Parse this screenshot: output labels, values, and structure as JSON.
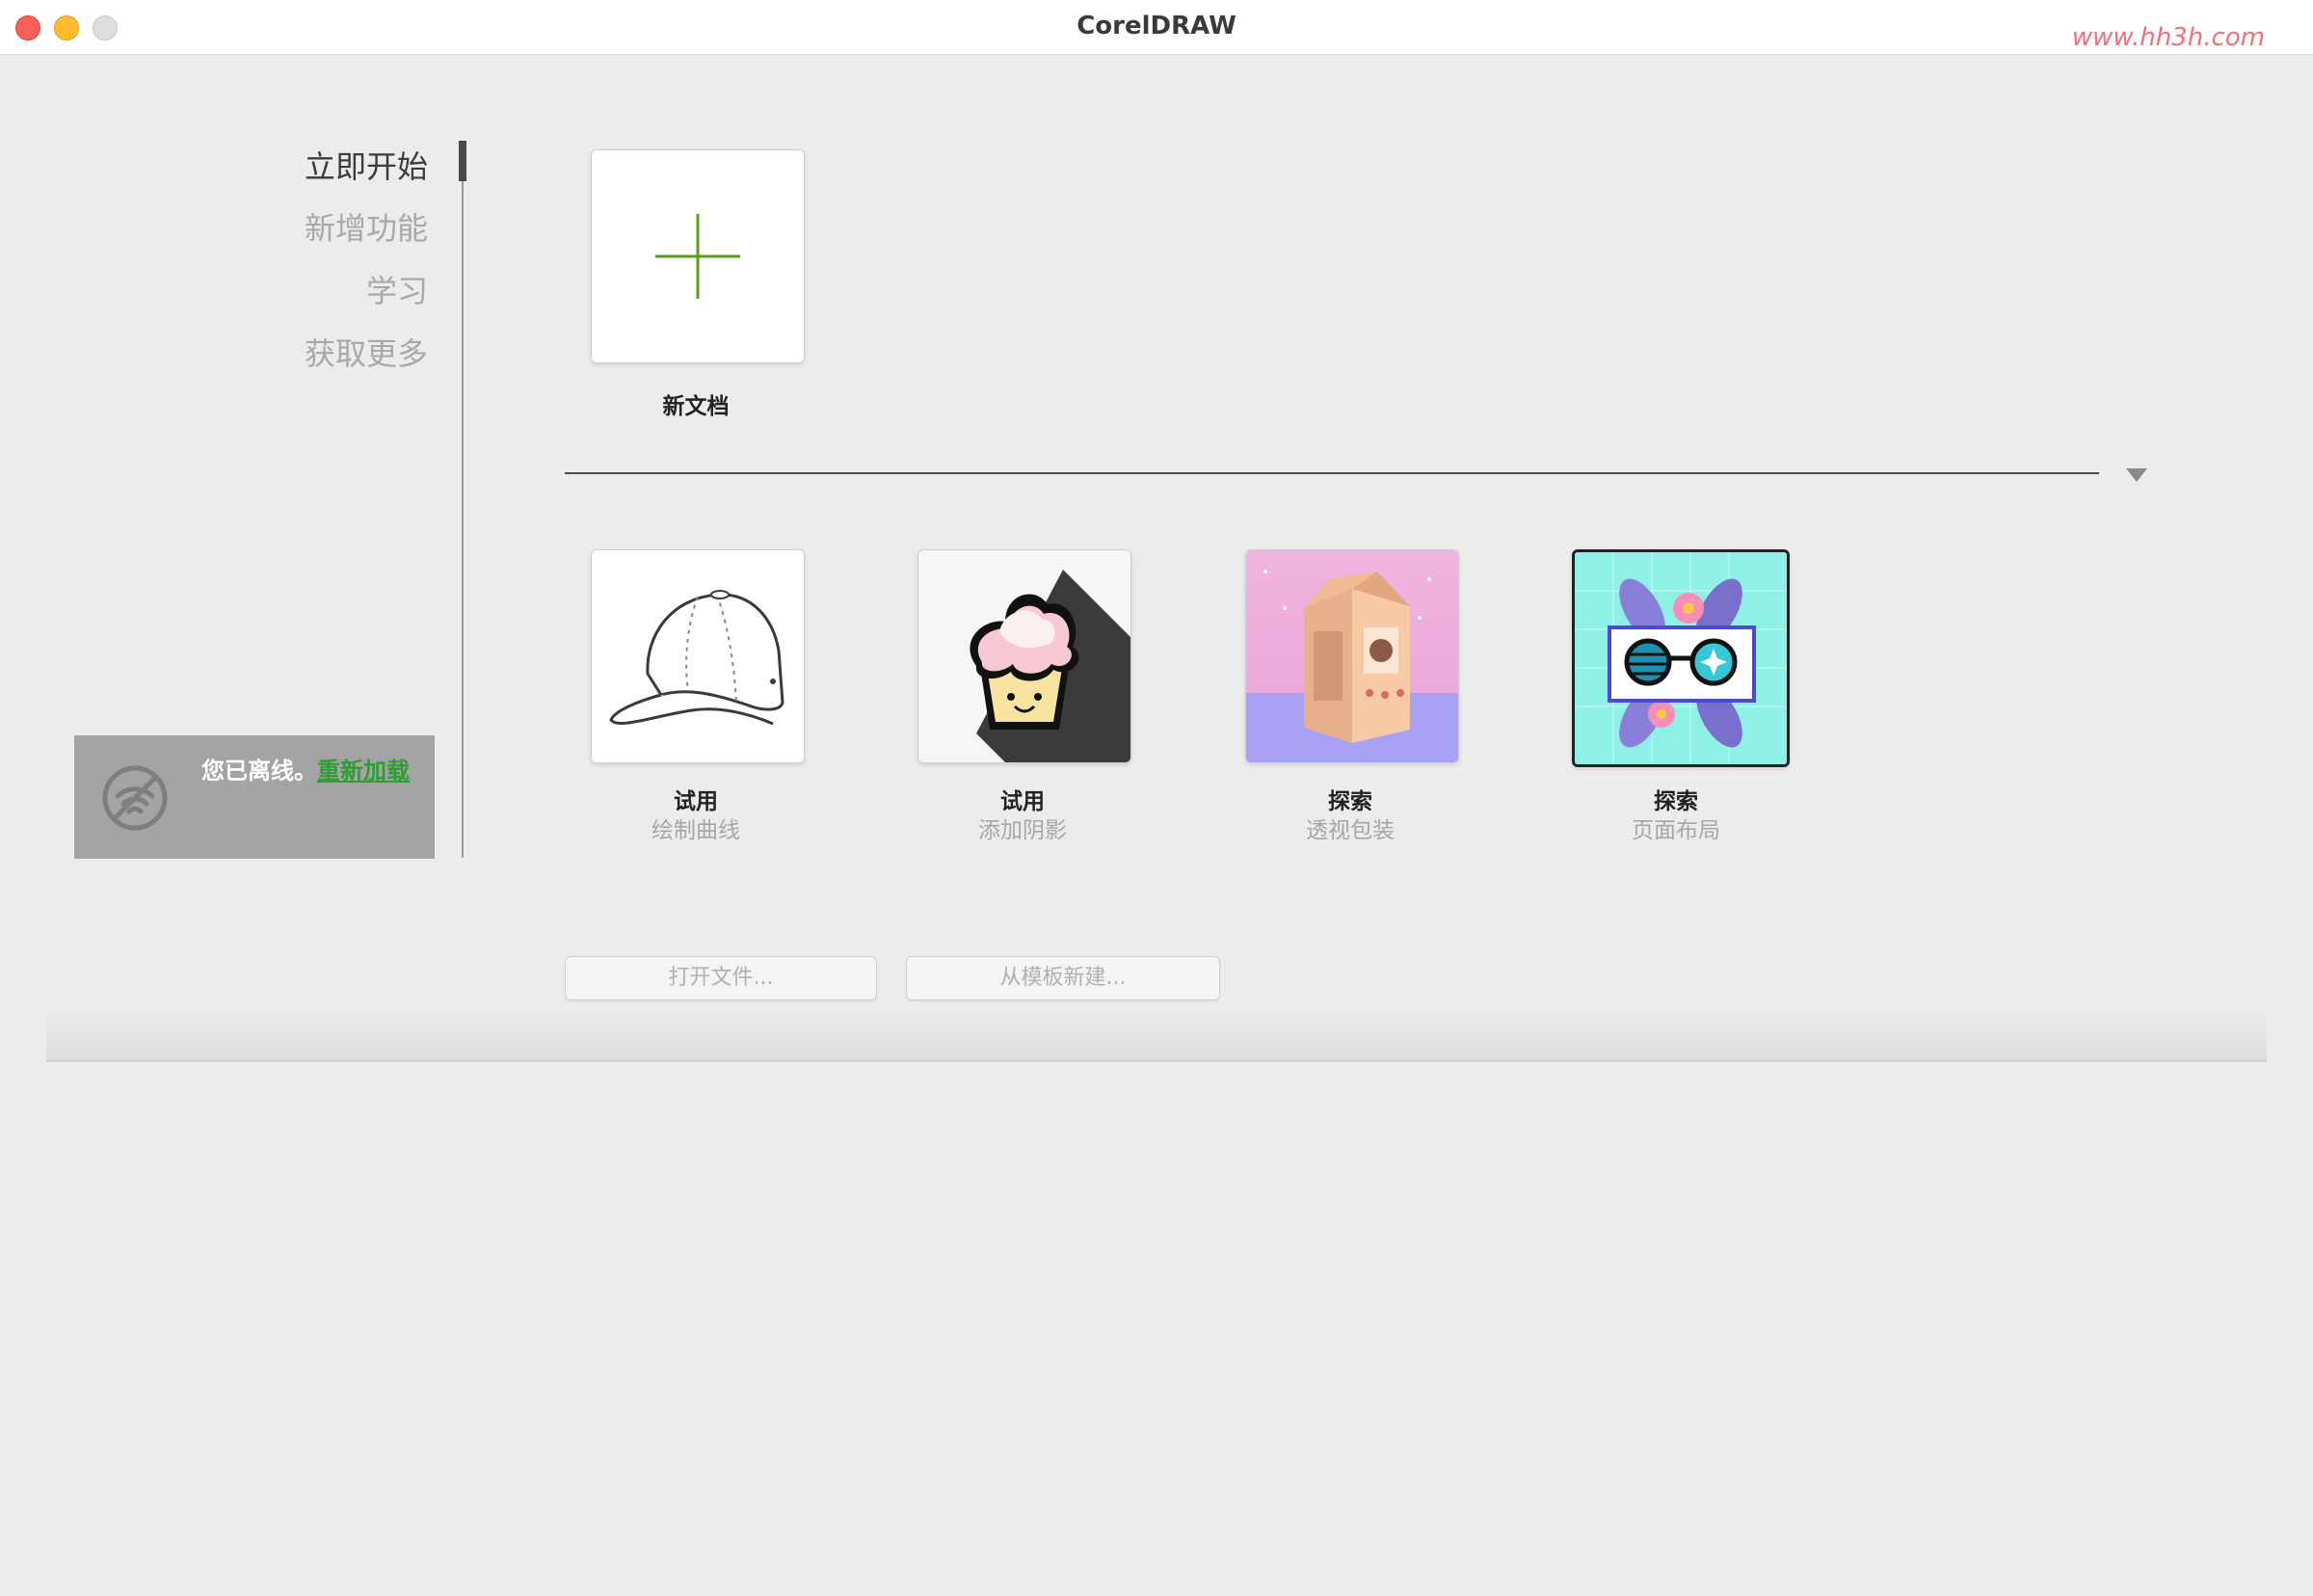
{
  "window": {
    "title": "CorelDRAW",
    "watermark": "www.hh3h.com"
  },
  "nav": {
    "items": [
      {
        "label": "立即开始",
        "active": true
      },
      {
        "label": "新增功能",
        "active": false
      },
      {
        "label": "学习",
        "active": false
      },
      {
        "label": "获取更多",
        "active": false
      }
    ]
  },
  "offline": {
    "message": "您已离线。",
    "reload_label": "重新加载",
    "icon": "no-wifi-icon"
  },
  "new_document": {
    "label": "新文档",
    "icon": "plus-icon",
    "accent_color": "#5a9e1c"
  },
  "tutorials": [
    {
      "title": "试用",
      "subtitle": "绘制曲线",
      "image": "baseball-cap-illustration"
    },
    {
      "title": "试用",
      "subtitle": "添加阴影",
      "image": "cupcake-illustration"
    },
    {
      "title": "探索",
      "subtitle": "透视包装",
      "image": "milk-carton-illustration"
    },
    {
      "title": "探索",
      "subtitle": "页面布局",
      "image": "sunglasses-flowers-illustration"
    }
  ],
  "buttons": {
    "open_file": "打开文件...",
    "new_from_template": "从模板新建..."
  }
}
